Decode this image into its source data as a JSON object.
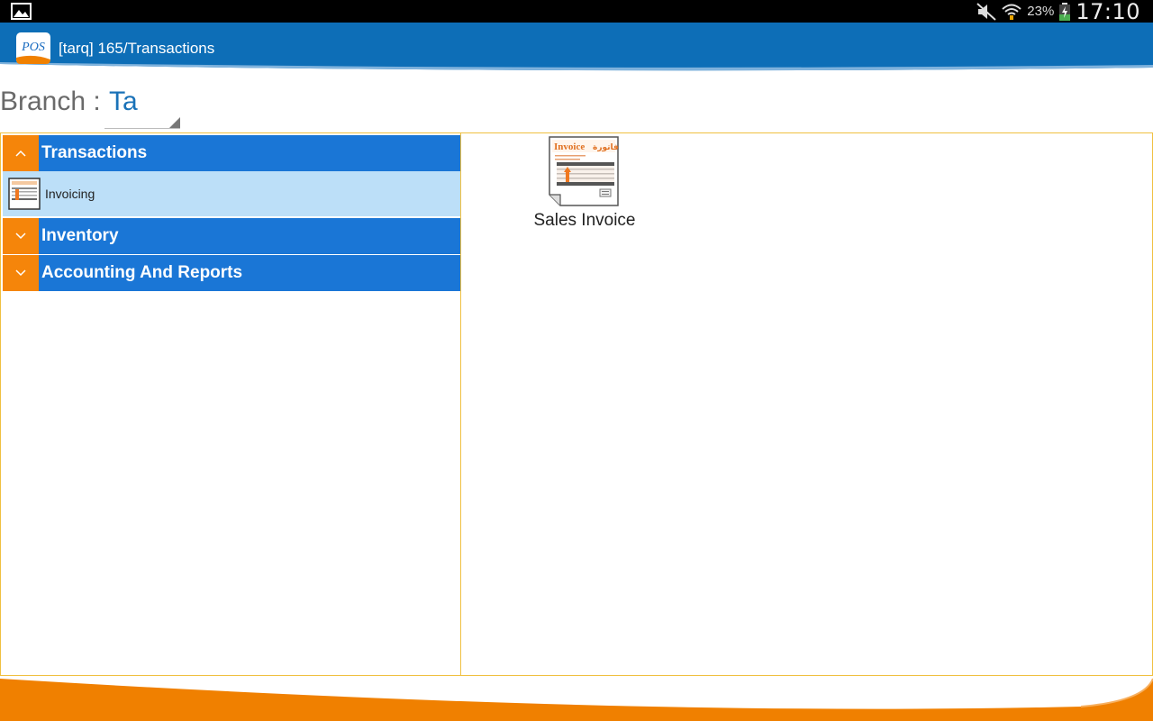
{
  "status_bar": {
    "battery_percent": "23%",
    "time": "17:10"
  },
  "action_bar": {
    "logo_text": "POS",
    "title": "[tarq] 165/Transactions"
  },
  "branch": {
    "label": "Branch :",
    "value": "Ta"
  },
  "menu": {
    "groups": [
      {
        "label": "Transactions",
        "expanded": true,
        "items": [
          {
            "label": "Invoicing"
          }
        ]
      },
      {
        "label": "Inventory",
        "expanded": false
      },
      {
        "label": "Accounting And Reports",
        "expanded": false
      }
    ]
  },
  "content": {
    "tiles": [
      {
        "label": "Sales Invoice",
        "icon": "invoice-icon"
      }
    ]
  },
  "colors": {
    "action_bar": "#0d6eb7",
    "group_header": "#1a76d6",
    "toggle": "#f5850a",
    "selected_item": "#bcdff8",
    "panel_border": "#f0c040",
    "footer": "#f08000"
  }
}
